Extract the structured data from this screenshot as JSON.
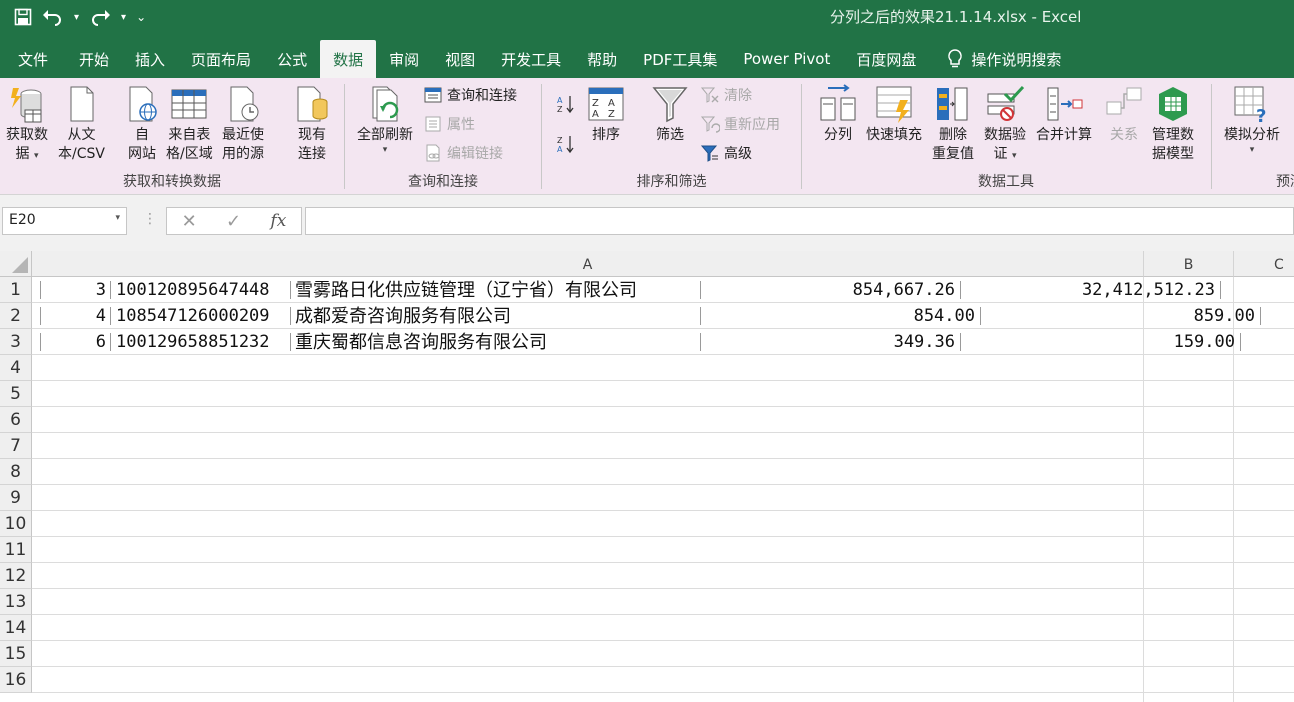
{
  "window": {
    "title": "分列之后的效果21.1.14.xlsx  -  Excel"
  },
  "qat": {
    "more": "⌄"
  },
  "tabs": [
    {
      "label": "文件"
    },
    {
      "label": "开始"
    },
    {
      "label": "插入"
    },
    {
      "label": "页面布局"
    },
    {
      "label": "公式"
    },
    {
      "label": "数据",
      "active": true
    },
    {
      "label": "审阅"
    },
    {
      "label": "视图"
    },
    {
      "label": "开发工具"
    },
    {
      "label": "帮助"
    },
    {
      "label": "PDF工具集"
    },
    {
      "label": "Power Pivot"
    },
    {
      "label": "百度网盘"
    },
    {
      "label": "操作说明搜索"
    }
  ],
  "ribbon": {
    "get_data": {
      "label": "获取和转换数据",
      "get_data_1": "获取数",
      "get_data_2": "据",
      "from_text_1": "从文",
      "from_text_2": "本/CSV",
      "from_web_1": "自",
      "from_web_2": "网站",
      "from_table_1": "来自表",
      "from_table_2": "格/区域",
      "recent_1": "最近使",
      "recent_2": "用的源",
      "existing_1": "现有",
      "existing_2": "连接"
    },
    "queries": {
      "label": "查询和连接",
      "refresh_all": "全部刷新",
      "queries_connections": "查询和连接",
      "properties": "属性",
      "edit_links": "编辑链接"
    },
    "sort_filter": {
      "label": "排序和筛选",
      "sort": "排序",
      "filter": "筛选",
      "clear": "清除",
      "reapply": "重新应用",
      "advanced": "高级"
    },
    "data_tools": {
      "label": "数据工具",
      "text_to_columns": "分列",
      "flash_fill": "快速填充",
      "remove_dup_1": "删除",
      "remove_dup_2": "重复值",
      "validation_1": "数据验",
      "validation_2": "证",
      "consolidate": "合并计算",
      "relationships": "关系",
      "data_model_1": "管理数",
      "data_model_2": "据模型"
    },
    "forecast": {
      "label": "预测",
      "what_if": "模拟分析"
    }
  },
  "formula_bar": {
    "name_box": "E20",
    "fx": "fx",
    "cancel": "✕",
    "enter": "✓",
    "value": ""
  },
  "columns": [
    {
      "label": "A"
    },
    {
      "label": "B"
    },
    {
      "label": "C"
    }
  ],
  "rows": [
    "1",
    "2",
    "3",
    "4",
    "5",
    "6",
    "7",
    "8",
    "9",
    "10",
    "11",
    "12",
    "13",
    "14",
    "15",
    "16"
  ],
  "cells": [
    {
      "n": "3",
      "account": "100120895647448",
      "company": "雪雾路日化供应链管理（辽宁省）有限公司",
      "amount1": "854,667.26",
      "amount2": "32,412,512.23"
    },
    {
      "n": "4",
      "account": "108547126000209",
      "company": "成都爱奇咨询服务有限公司",
      "amount1": "854.00",
      "amount2": "859.00"
    },
    {
      "n": "6",
      "account": "100129658851232",
      "company": "重庆蜀都信息咨询服务有限公司",
      "amount1": "349.36",
      "amount2": "159.00"
    }
  ],
  "colors": {
    "excel_green": "#217346",
    "ribbon_bg": "#f3e6f1"
  }
}
